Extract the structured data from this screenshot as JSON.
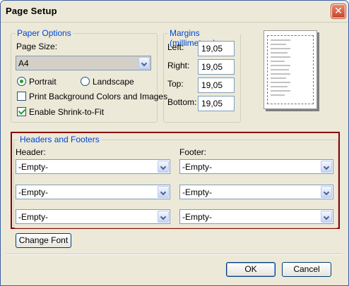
{
  "window": {
    "title": "Page Setup",
    "close_glyph": "✕"
  },
  "paper_options": {
    "legend": "Paper Options",
    "page_size_label": "Page Size:",
    "page_size_value": "A4",
    "portrait_label": "Portrait",
    "landscape_label": "Landscape",
    "orientation_selected": "portrait",
    "print_bg_label": "Print Background Colors and Images",
    "print_bg_checked": false,
    "shrink_label": "Enable Shrink-to-Fit",
    "shrink_checked": true
  },
  "margins": {
    "legend": "Margins (millimeters)",
    "left_label": "Left:",
    "left_value": "19,05",
    "right_label": "Right:",
    "right_value": "19,05",
    "top_label": "Top:",
    "top_value": "19,05",
    "bottom_label": "Bottom:",
    "bottom_value": "19,05"
  },
  "headers_footers": {
    "legend": "Headers and Footers",
    "header_label": "Header:",
    "footer_label": "Footer:",
    "header_values": [
      "-Empty-",
      "-Empty-",
      "-Empty-"
    ],
    "footer_values": [
      "-Empty-",
      "-Empty-",
      "-Empty-"
    ]
  },
  "buttons": {
    "change_font": "Change Font",
    "ok": "OK",
    "cancel": "Cancel"
  },
  "colors": {
    "legend_text": "#0046d5",
    "highlight_border": "#8b0000",
    "dialog_bg": "#ece9d8"
  }
}
